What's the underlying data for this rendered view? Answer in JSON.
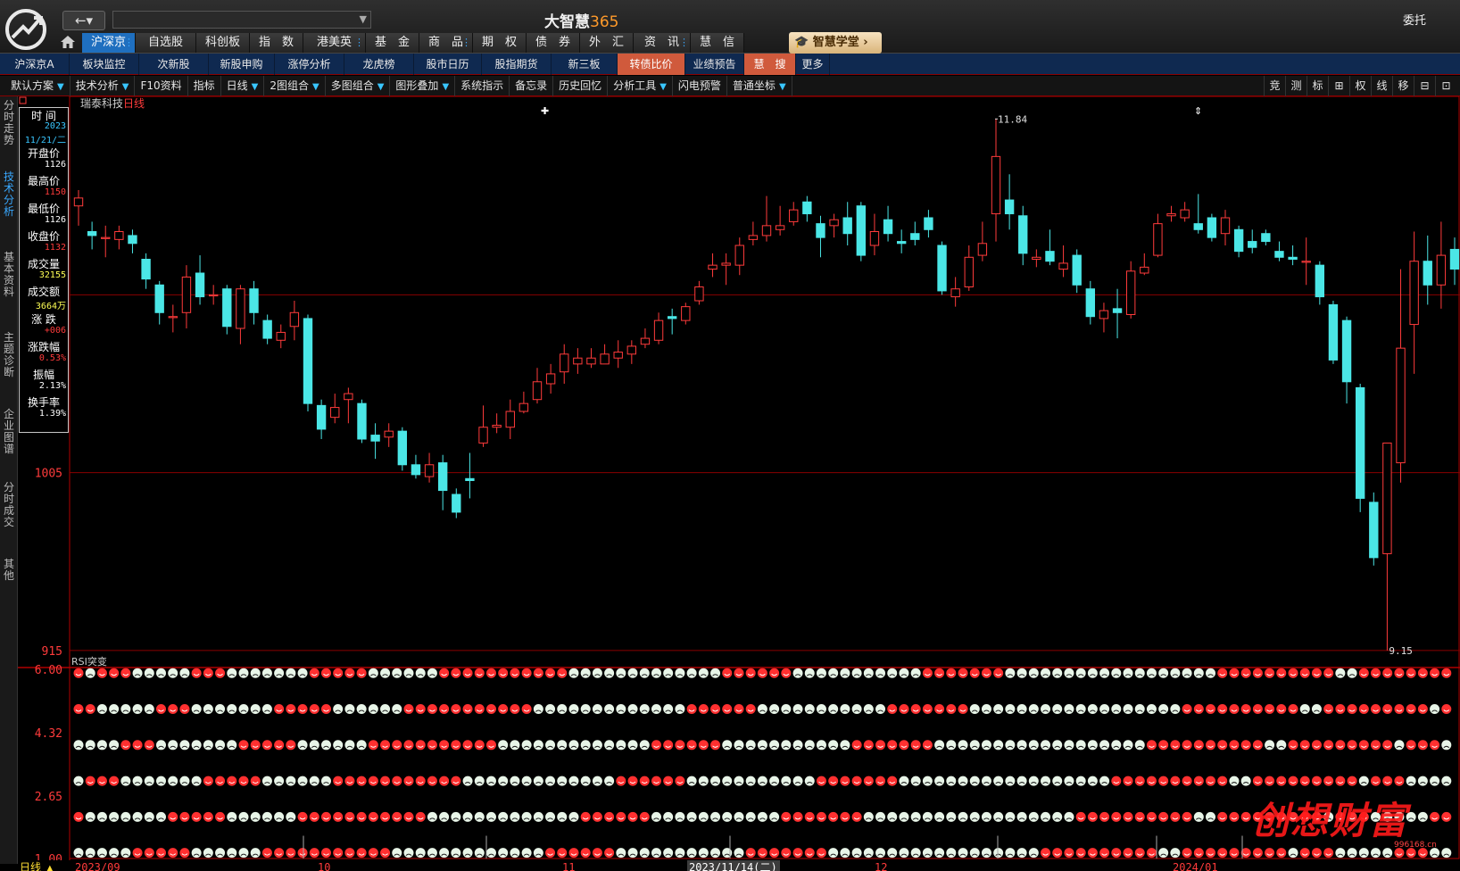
{
  "app": {
    "title_text": "大智慧",
    "title_num": "365",
    "entrust": "委托",
    "academy": "智慧学堂",
    "nav_arrows": "←▾"
  },
  "main_menu": [
    {
      "label": "沪深京",
      "active": true
    },
    {
      "label": "自选股"
    },
    {
      "label": "科创板"
    },
    {
      "label": "指　数"
    },
    {
      "label": "港美英"
    },
    {
      "label": "基　金"
    },
    {
      "label": "商　品"
    },
    {
      "label": "期　权"
    },
    {
      "label": "债　券"
    },
    {
      "label": "外　汇"
    },
    {
      "label": "资　讯"
    },
    {
      "label": "慧　信"
    }
  ],
  "sub_menu": [
    {
      "label": "沪深京A"
    },
    {
      "label": "板块监控"
    },
    {
      "label": "次新股"
    },
    {
      "label": "新股申购"
    },
    {
      "label": "涨停分析"
    },
    {
      "label": "龙虎榜"
    },
    {
      "label": "股市日历"
    },
    {
      "label": "股指期货"
    },
    {
      "label": "新三板"
    },
    {
      "label": "转债比价",
      "highlight": true
    },
    {
      "label": "业绩预告"
    },
    {
      "label": "慧　搜",
      "highlight": true
    },
    {
      "label": "更多"
    }
  ],
  "toolbar": [
    {
      "label": "默认方案",
      "dropdown": true
    },
    {
      "label": "技术分析",
      "dropdown": true
    },
    {
      "label": "F10资料"
    },
    {
      "label": "指标"
    },
    {
      "label": "日线",
      "dropdown": true
    },
    {
      "label": "2图组合",
      "dropdown": true
    },
    {
      "label": "多图组合",
      "dropdown": true
    },
    {
      "label": "图形叠加",
      "dropdown": true
    },
    {
      "label": "系统指示"
    },
    {
      "label": "备忘录"
    },
    {
      "label": "历史回忆"
    },
    {
      "label": "分析工具",
      "dropdown": true
    },
    {
      "label": "闪电预警"
    },
    {
      "label": "普通坐标",
      "dropdown": true
    }
  ],
  "right_tools": [
    "竞",
    "测",
    "标",
    "⊞",
    "权",
    "线",
    "移",
    "⊟",
    "⊡"
  ],
  "vertical_tabs": [
    "分时走势",
    "技术分析",
    "基本资料",
    "主题诊断",
    "企业图谱",
    "分时成交",
    "其他"
  ],
  "stock": {
    "name": "瑞泰科技",
    "period": "日线"
  },
  "info_panel": {
    "time_label": "时 间",
    "date_year": "2023",
    "date_md": "11/21/二",
    "rows": [
      {
        "label": "开盘价",
        "value": "1126",
        "color": "#ffffff"
      },
      {
        "label": "最高价",
        "value": "1150",
        "color": "#ff3b3b"
      },
      {
        "label": "最低价",
        "value": "1126",
        "color": "#ffffff"
      },
      {
        "label": "收盘价",
        "value": "1132",
        "color": "#ff3b3b"
      },
      {
        "label": "成交量",
        "value": "32155",
        "color": "#ffff55"
      },
      {
        "label": "成交额",
        "value": "3664万",
        "color": "#ffff55"
      },
      {
        "label": "涨 跌",
        "value": "+006",
        "color": "#ff3b3b"
      },
      {
        "label": "涨跌幅",
        "value": "0.53%",
        "color": "#ff3b3b"
      },
      {
        "label": "振幅",
        "value": "2.13%",
        "color": "#ffffff"
      },
      {
        "label": "换手率",
        "value": "1.39%",
        "color": "#ffffff"
      }
    ]
  },
  "chart_data": {
    "type": "candlestick",
    "price_axis_ticks": [
      "1005",
      "915"
    ],
    "price_ylim": [
      9.1,
      11.9
    ],
    "high_marker": "11.84",
    "low_marker": "9.15",
    "indicator": {
      "name": "RSI突变",
      "ticks": [
        "6.00",
        "4.32",
        "2.65",
        "1.00"
      ],
      "ylim": [
        1.0,
        6.0
      ]
    },
    "date_labels": [
      "2023/09",
      "10",
      "11",
      "2023/11/14(二)",
      "12",
      "2024/01"
    ],
    "bottom_tab": "日线",
    "candles": [
      [
        11.4,
        11.44,
        11.48,
        11.3
      ],
      [
        11.27,
        11.25,
        11.32,
        11.18
      ],
      [
        11.24,
        11.24,
        11.3,
        11.14
      ],
      [
        11.23,
        11.27,
        11.3,
        11.18
      ],
      [
        11.25,
        11.21,
        11.28,
        11.16
      ],
      [
        11.13,
        11.03,
        11.16,
        10.98
      ],
      [
        11.0,
        10.86,
        11.02,
        10.8
      ],
      [
        10.84,
        10.84,
        10.9,
        10.76
      ],
      [
        10.86,
        11.04,
        11.1,
        10.78
      ],
      [
        11.06,
        10.94,
        11.15,
        10.9
      ],
      [
        10.95,
        10.95,
        11.0,
        10.9
      ],
      [
        10.98,
        10.79,
        11.0,
        10.75
      ],
      [
        10.78,
        10.98,
        11.0,
        10.7
      ],
      [
        10.98,
        10.86,
        11.02,
        10.8
      ],
      [
        10.82,
        10.73,
        10.85,
        10.7
      ],
      [
        10.72,
        10.76,
        10.8,
        10.68
      ],
      [
        10.79,
        10.86,
        10.92,
        10.72
      ],
      [
        10.83,
        10.4,
        10.85,
        10.36
      ],
      [
        10.39,
        10.27,
        10.42,
        10.22
      ],
      [
        10.33,
        10.38,
        10.45,
        10.3
      ],
      [
        10.42,
        10.45,
        10.48,
        10.3
      ],
      [
        10.4,
        10.22,
        10.42,
        10.2
      ],
      [
        10.24,
        10.21,
        10.3,
        10.12
      ],
      [
        10.23,
        10.26,
        10.3,
        10.18
      ],
      [
        10.26,
        10.09,
        10.28,
        10.06
      ],
      [
        10.09,
        10.04,
        10.14,
        10.02
      ],
      [
        10.03,
        10.09,
        10.15,
        10.0
      ],
      [
        10.1,
        9.96,
        10.14,
        9.86
      ],
      [
        9.94,
        9.85,
        9.97,
        9.82
      ],
      [
        10.02,
        10.01,
        10.15,
        9.92
      ],
      [
        10.2,
        10.28,
        10.39,
        10.18
      ],
      [
        10.28,
        10.29,
        10.35,
        10.25
      ],
      [
        10.28,
        10.36,
        10.42,
        10.22
      ],
      [
        10.36,
        10.4,
        10.46,
        10.35
      ],
      [
        10.42,
        10.51,
        10.58,
        10.4
      ],
      [
        10.5,
        10.55,
        10.6,
        10.45
      ],
      [
        10.56,
        10.65,
        10.7,
        10.5
      ],
      [
        10.6,
        10.63,
        10.68,
        10.55
      ],
      [
        10.6,
        10.63,
        10.68,
        10.58
      ],
      [
        10.6,
        10.65,
        10.7,
        10.6
      ],
      [
        10.63,
        10.66,
        10.72,
        10.58
      ],
      [
        10.65,
        10.69,
        10.72,
        10.6
      ],
      [
        10.7,
        10.73,
        10.78,
        10.68
      ],
      [
        10.72,
        10.82,
        10.86,
        10.7
      ],
      [
        10.84,
        10.83,
        10.88,
        10.75
      ],
      [
        10.82,
        10.89,
        10.91,
        10.8
      ],
      [
        10.92,
        10.99,
        11.02,
        10.9
      ],
      [
        11.08,
        11.1,
        11.16,
        11.04
      ],
      [
        11.1,
        11.11,
        11.16,
        11.0
      ],
      [
        11.1,
        11.2,
        11.24,
        11.05
      ],
      [
        11.23,
        11.25,
        11.32,
        11.2
      ],
      [
        11.25,
        11.3,
        11.45,
        11.22
      ],
      [
        11.28,
        11.3,
        11.4,
        11.25
      ],
      [
        11.32,
        11.38,
        11.42,
        11.3
      ],
      [
        11.42,
        11.36,
        11.45,
        11.32
      ],
      [
        11.31,
        11.24,
        11.35,
        11.14
      ],
      [
        11.3,
        11.33,
        11.36,
        11.24
      ],
      [
        11.34,
        11.26,
        11.42,
        11.2
      ],
      [
        11.4,
        11.15,
        11.42,
        11.12
      ],
      [
        11.2,
        11.27,
        11.36,
        11.15
      ],
      [
        11.33,
        11.26,
        11.4,
        11.22
      ],
      [
        11.22,
        11.21,
        11.28,
        11.16
      ],
      [
        11.26,
        11.23,
        11.32,
        11.2
      ],
      [
        11.34,
        11.28,
        11.38,
        11.24
      ],
      [
        11.2,
        10.97,
        11.22,
        10.95
      ],
      [
        10.94,
        10.98,
        11.04,
        10.89
      ],
      [
        10.99,
        11.14,
        11.2,
        10.97
      ],
      [
        11.15,
        11.21,
        11.32,
        11.12
      ],
      [
        11.36,
        11.65,
        11.84,
        11.22
      ],
      [
        11.43,
        11.36,
        11.56,
        11.28
      ],
      [
        11.35,
        11.16,
        11.4,
        11.1
      ],
      [
        11.13,
        11.14,
        11.18,
        11.09
      ],
      [
        11.17,
        11.12,
        11.28,
        11.1
      ],
      [
        11.08,
        11.11,
        11.2,
        11.04
      ],
      [
        11.15,
        11.0,
        11.18,
        10.96
      ],
      [
        10.98,
        10.84,
        11.02,
        10.8
      ],
      [
        10.83,
        10.87,
        10.91,
        10.76
      ],
      [
        10.88,
        10.86,
        10.98,
        10.73
      ],
      [
        10.85,
        11.07,
        11.12,
        10.83
      ],
      [
        11.06,
        11.09,
        11.16,
        11.05
      ],
      [
        11.15,
        11.31,
        11.36,
        11.14
      ],
      [
        11.35,
        11.36,
        11.4,
        11.32
      ],
      [
        11.34,
        11.38,
        11.42,
        11.32
      ],
      [
        11.31,
        11.28,
        11.46,
        11.26
      ],
      [
        11.34,
        11.24,
        11.36,
        11.22
      ],
      [
        11.26,
        11.34,
        11.38,
        11.2
      ],
      [
        11.28,
        11.17,
        11.3,
        11.14
      ],
      [
        11.22,
        11.19,
        11.28,
        11.16
      ],
      [
        11.26,
        11.22,
        11.28,
        11.2
      ],
      [
        11.17,
        11.14,
        11.22,
        11.12
      ],
      [
        11.14,
        11.13,
        11.2,
        11.1
      ],
      [
        11.12,
        11.12,
        11.24,
        11.0
      ],
      [
        11.1,
        10.94,
        11.12,
        10.9
      ],
      [
        10.9,
        10.62,
        10.92,
        10.6
      ],
      [
        10.82,
        10.51,
        10.84,
        10.4
      ],
      [
        10.48,
        9.92,
        10.5,
        9.85
      ],
      [
        9.9,
        9.62,
        9.95,
        9.58
      ],
      [
        9.64,
        10.2,
        10.2,
        9.15
      ],
      [
        10.1,
        10.68,
        11.08,
        10.0
      ],
      [
        10.8,
        11.12,
        11.27,
        10.55
      ],
      [
        11.12,
        11.0,
        11.25,
        10.9
      ],
      [
        11.0,
        11.15,
        11.32,
        10.88
      ],
      [
        11.18,
        11.08,
        11.24,
        11.0
      ]
    ],
    "signal_rows": [
      "r",
      "g",
      "r",
      "r",
      "r",
      "g",
      "g",
      "g",
      "g",
      "g",
      "r",
      "r",
      "r",
      "g",
      "g",
      "g",
      "g",
      "g",
      "g",
      "g",
      "r",
      "r",
      "r",
      "r",
      "r",
      "g",
      "g",
      "g",
      "g",
      "g",
      "g",
      "r",
      "r",
      "r",
      "r",
      "r",
      "r",
      "r",
      "r",
      "r",
      "r",
      "r",
      "g",
      "g",
      "g",
      "g",
      "g",
      "g",
      "g",
      "g",
      "g",
      "g",
      "g",
      "g",
      "g",
      "r",
      "r",
      "r",
      "r",
      "r",
      "r",
      "g",
      "g",
      "g",
      "g",
      "g",
      "g",
      "g",
      "g",
      "g",
      "g",
      "g",
      "r",
      "r",
      "r",
      "r",
      "r",
      "r",
      "r",
      "g",
      "g",
      "g",
      "g",
      "g",
      "g",
      "g",
      "g",
      "g",
      "g",
      "g",
      "g",
      "g",
      "g",
      "g",
      "g",
      "g",
      "g",
      "r",
      "r",
      "r",
      "r",
      "r",
      "r",
      "r",
      "r",
      "r",
      "r",
      "g",
      "g",
      "r",
      "r",
      "r",
      "r",
      "r",
      "r",
      "r",
      "r"
    ]
  },
  "watermark": {
    "text": "创想财富",
    "url": "996168.cn"
  },
  "colors": {
    "up": "#ff3b3b",
    "down": "#4be6e6",
    "grid": "#8a0000",
    "frame": "#b00000"
  }
}
